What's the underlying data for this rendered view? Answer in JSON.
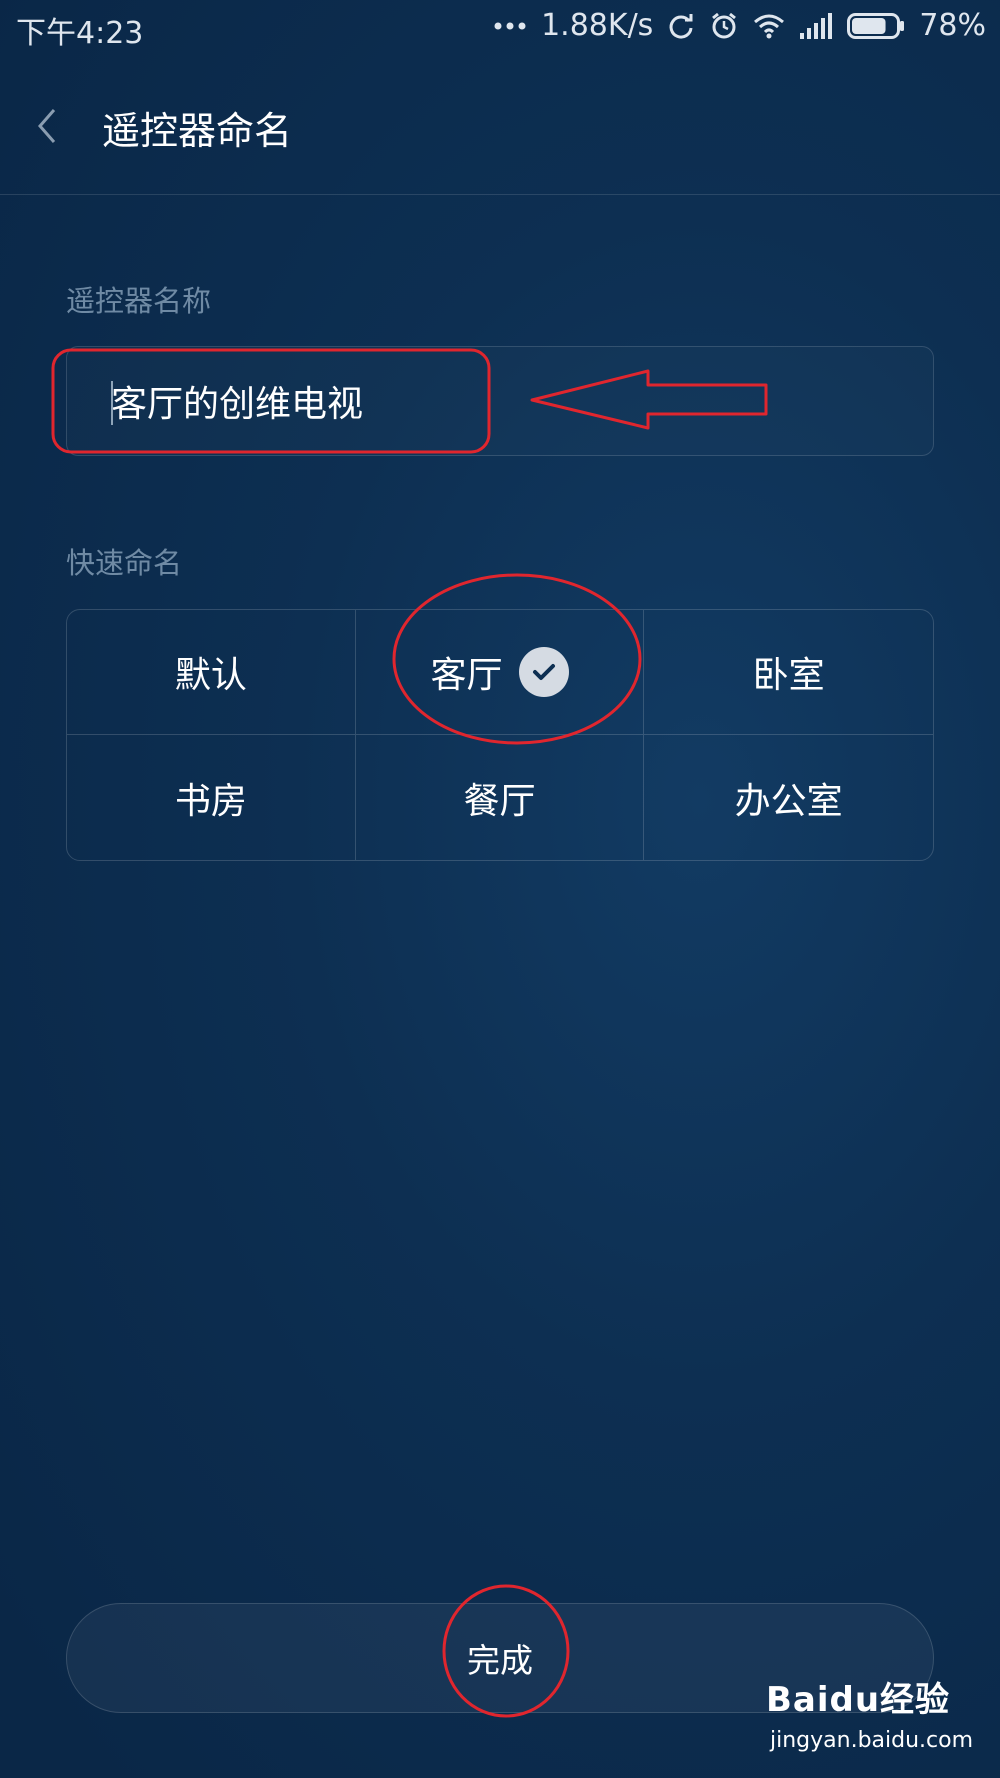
{
  "status_bar": {
    "time": "下午4:23",
    "network_speed": "1.88K/s",
    "battery_percent": "78%",
    "battery_level": 0.78,
    "icons": [
      "more-dots-icon",
      "sync-icon",
      "alarm-icon",
      "wifi-icon",
      "signal-icon",
      "battery-icon"
    ]
  },
  "header": {
    "title": "遥控器命名",
    "back_icon": "chevron-left-icon"
  },
  "name_section": {
    "label": "遥控器名称",
    "input_value": "客厅的创维电视"
  },
  "quick_section": {
    "label": "快速命名",
    "options": [
      {
        "label": "默认",
        "selected": false
      },
      {
        "label": "客厅",
        "selected": true
      },
      {
        "label": "卧室",
        "selected": false
      },
      {
        "label": "书房",
        "selected": false
      },
      {
        "label": "餐厅",
        "selected": false
      },
      {
        "label": "办公室",
        "selected": false
      }
    ]
  },
  "footer": {
    "done_label": "完成"
  },
  "watermark": {
    "brand": "Baidu经验",
    "url": "jingyan.baidu.com"
  },
  "colors": {
    "background": "#0d2f52",
    "annotation": "#e0262e",
    "section_label": "#6f8aa4",
    "check_badge": "#d5dbe3"
  }
}
